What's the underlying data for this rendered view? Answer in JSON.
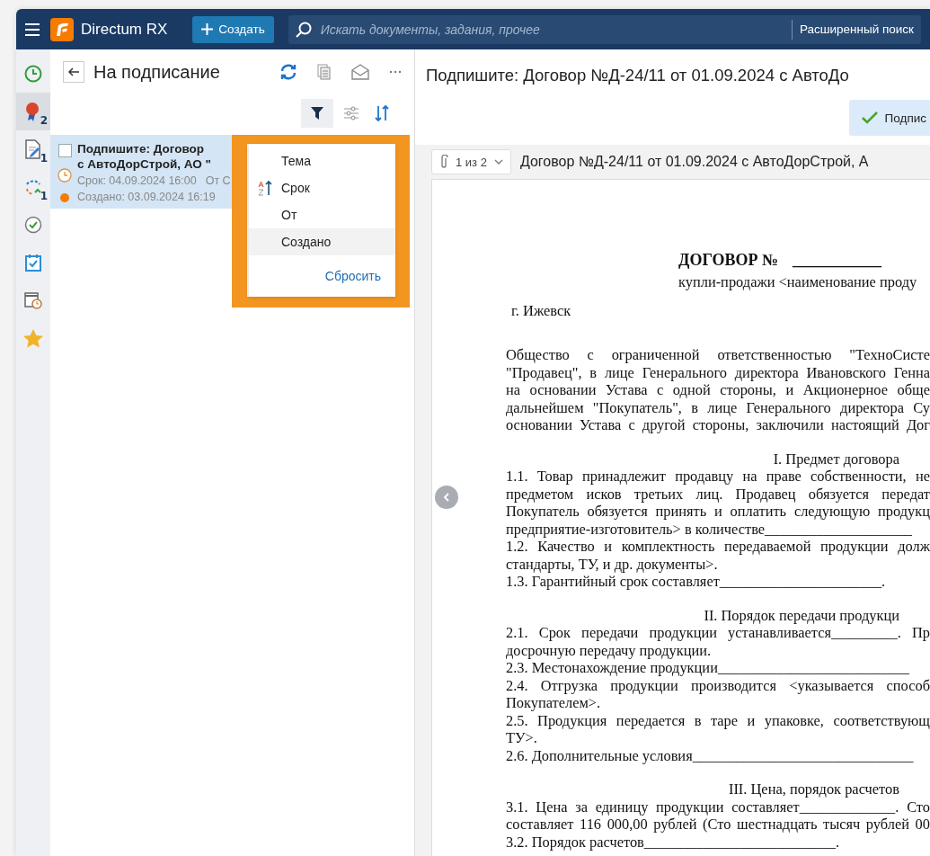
{
  "app": {
    "name": "Directum RX"
  },
  "header": {
    "create_label": "Создать",
    "search": {
      "placeholder": "Искать документы, задания, прочее"
    },
    "advanced_search": "Расширенный поиск"
  },
  "rail": [
    {
      "kind": "clock",
      "selected": false
    },
    {
      "kind": "ribbon",
      "selected": true,
      "badge": "2"
    },
    {
      "kind": "doc-edit",
      "selected": false,
      "badge": "1"
    },
    {
      "kind": "cycle",
      "selected": false,
      "badge": "1"
    },
    {
      "kind": "check-circle",
      "selected": false
    },
    {
      "kind": "calendar-check",
      "selected": false
    },
    {
      "kind": "calendar-clock",
      "selected": false
    },
    {
      "kind": "star",
      "selected": false
    }
  ],
  "list_panel": {
    "title": "На подписание",
    "filter_active": true,
    "items": [
      {
        "selected": true,
        "checked": false,
        "title_lines": [
          "Подпишите: Договор",
          "с АвтоДорСтрой, АО \""
        ],
        "due": "Срок: 04.09.2024 16:00",
        "from": "От С",
        "created": "Создано: 03.09.2024 16:19",
        "color": "#f57c00"
      }
    ],
    "sort_menu": {
      "items": [
        {
          "label": "Тема",
          "selected": false,
          "hovered": false
        },
        {
          "label": "Срок",
          "selected": true,
          "hovered": false
        },
        {
          "label": "От",
          "selected": false,
          "hovered": false
        },
        {
          "label": "Создано",
          "selected": false,
          "hovered": true
        }
      ],
      "reset": "Сбросить"
    }
  },
  "preview": {
    "title": "Подпишите: Договор №Д-24/11 от 01.09.2024 с АвтоДо",
    "sign_button": "Подпис",
    "attachment_counter": "1 из 2",
    "document_name": "Договор №Д-24/11 от 01.09.2024 с АвтоДорСтрой, А",
    "document": {
      "blocks": [
        {
          "lines": [
            {
              "kind": "title",
              "text": "ДОГОВОР №",
              "blank": "___________"
            },
            {
              "kind": "subtitle",
              "text": "купли-продажи <наименование проду"
            }
          ]
        },
        {
          "lines": [
            {
              "kind": "city",
              "text": "г. Ижевск"
            }
          ]
        },
        {
          "lines": [
            {
              "kind": "justify",
              "text": "Общество с ограниченной ответственностью \"ТехноСисте"
            },
            {
              "kind": "justify",
              "text": "\"Продавец\", в лице Генерального директора Ивановского Генна"
            },
            {
              "kind": "justify",
              "text": "на основании Устава с одной стороны, и Акционерное обще"
            },
            {
              "kind": "justify",
              "text": "дальнейшем \"Покупатель\", в лице Генерального директора Су"
            },
            {
              "kind": "justify",
              "text": "основании Устава с другой стороны, заключили настоящий Дог"
            }
          ]
        },
        {
          "lines": [
            {
              "kind": "heading",
              "text": "I. Предмет договора"
            },
            {
              "kind": "justify",
              "text": "1.1. Товар принадлежит продавцу на праве собственности, не"
            },
            {
              "kind": "justify",
              "text": "предметом исков третьих лиц. Продавец обязуется передат"
            },
            {
              "kind": "justify",
              "text": "Покупатель обязуется принять и оплатить следующую продукц"
            },
            {
              "kind": "left",
              "text": "предприятие-изготовитель> в количестве____________________"
            },
            {
              "kind": "justify",
              "text": "1.2. Качество и комплектность передаваемой продукции долж"
            },
            {
              "kind": "left",
              "text": "стандарты, ТУ, и др. документы>."
            },
            {
              "kind": "left",
              "text": "1.3. Гарантийный срок составляет______________________."
            }
          ]
        },
        {
          "lines": [
            {
              "kind": "heading",
              "text": "II. Порядок передачи продукци"
            },
            {
              "kind": "justify",
              "text": "2.1. Срок передачи продукции устанавливается_________. Пр"
            },
            {
              "kind": "left",
              "text": "досрочную передачу продукции."
            },
            {
              "kind": "left",
              "text": "2.3. Местонахождение продукции__________________________"
            },
            {
              "kind": "justify",
              "text": "2.4. Отгрузка продукции производится <указывается способ"
            },
            {
              "kind": "left",
              "text": "Покупателем>."
            },
            {
              "kind": "justify",
              "text": "2.5. Продукция передается в таре и упаковке, соответствующ"
            },
            {
              "kind": "left",
              "text": "ТУ>."
            },
            {
              "kind": "left",
              "text": "2.6. Дополнительные условия______________________________"
            }
          ]
        },
        {
          "lines": [
            {
              "kind": "heading",
              "text": "III. Цена, порядок расчетов"
            },
            {
              "kind": "justify",
              "text": "3.1. Цена за единицу продукции составляет_____________. Сто"
            },
            {
              "kind": "justify",
              "text": "составляет 116 000,00 рублей (Сто шестнадцать тысяч рублей 00"
            },
            {
              "kind": "left",
              "text": "3.2. Порядок расчетов__________________________."
            }
          ]
        }
      ]
    }
  }
}
